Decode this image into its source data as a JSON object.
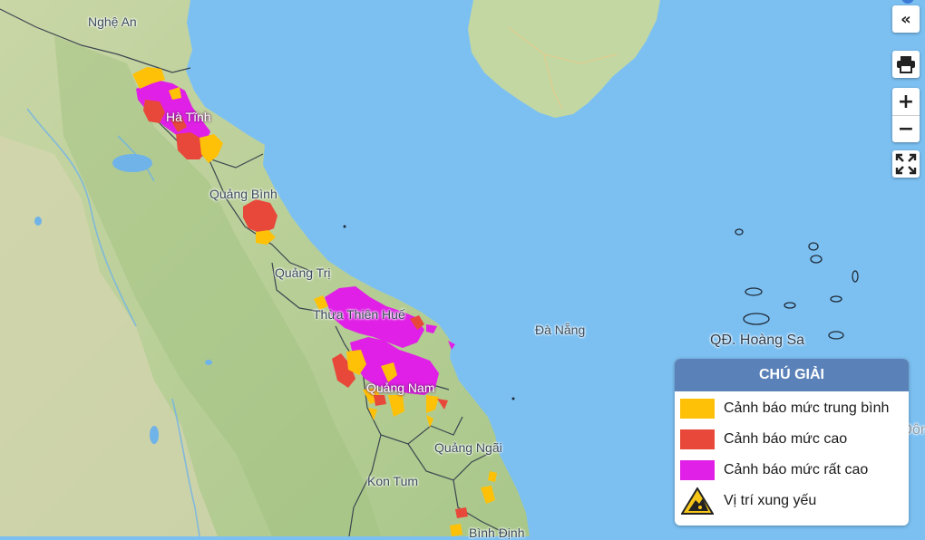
{
  "map_labels": {
    "nghe_an": "Nghệ An",
    "ha_tinh": "Hà Tĩnh",
    "quang_binh": "Quảng Bình",
    "quang_tri": "Quảng Trị",
    "thua_thien_hue": "Thừa Thiên Huế",
    "da_nang": "Đà Nẵng",
    "quang_nam": "Quảng Nam",
    "quang_ngai": "Quảng Ngãi",
    "kon_tum": "Kon Tum",
    "binh_dinh": "Bình Định",
    "hoang_sa": "QĐ. Hoàng Sa",
    "bien_dong": "Biển Đông"
  },
  "controls": {
    "collapse": "«",
    "zoom_in": "+",
    "zoom_out": "−"
  },
  "legend": {
    "title": "CHÚ GIẢI",
    "items": [
      {
        "label": "Cảnh báo mức trung bình",
        "color": "#ffc107"
      },
      {
        "label": "Cảnh báo mức cao",
        "color": "#e8483a"
      },
      {
        "label": "Cảnh báo mức rất cao",
        "color": "#e020e6"
      },
      {
        "label": "Vị trí xung yếu",
        "icon": "landslide-warning-icon"
      }
    ]
  },
  "colors": {
    "sea": "#7cc0f2",
    "land": "#c6d9a6",
    "warning_medium": "#ffc107",
    "warning_high": "#e8483a",
    "warning_very_high": "#e020e6",
    "legend_header": "#5b82b8"
  }
}
